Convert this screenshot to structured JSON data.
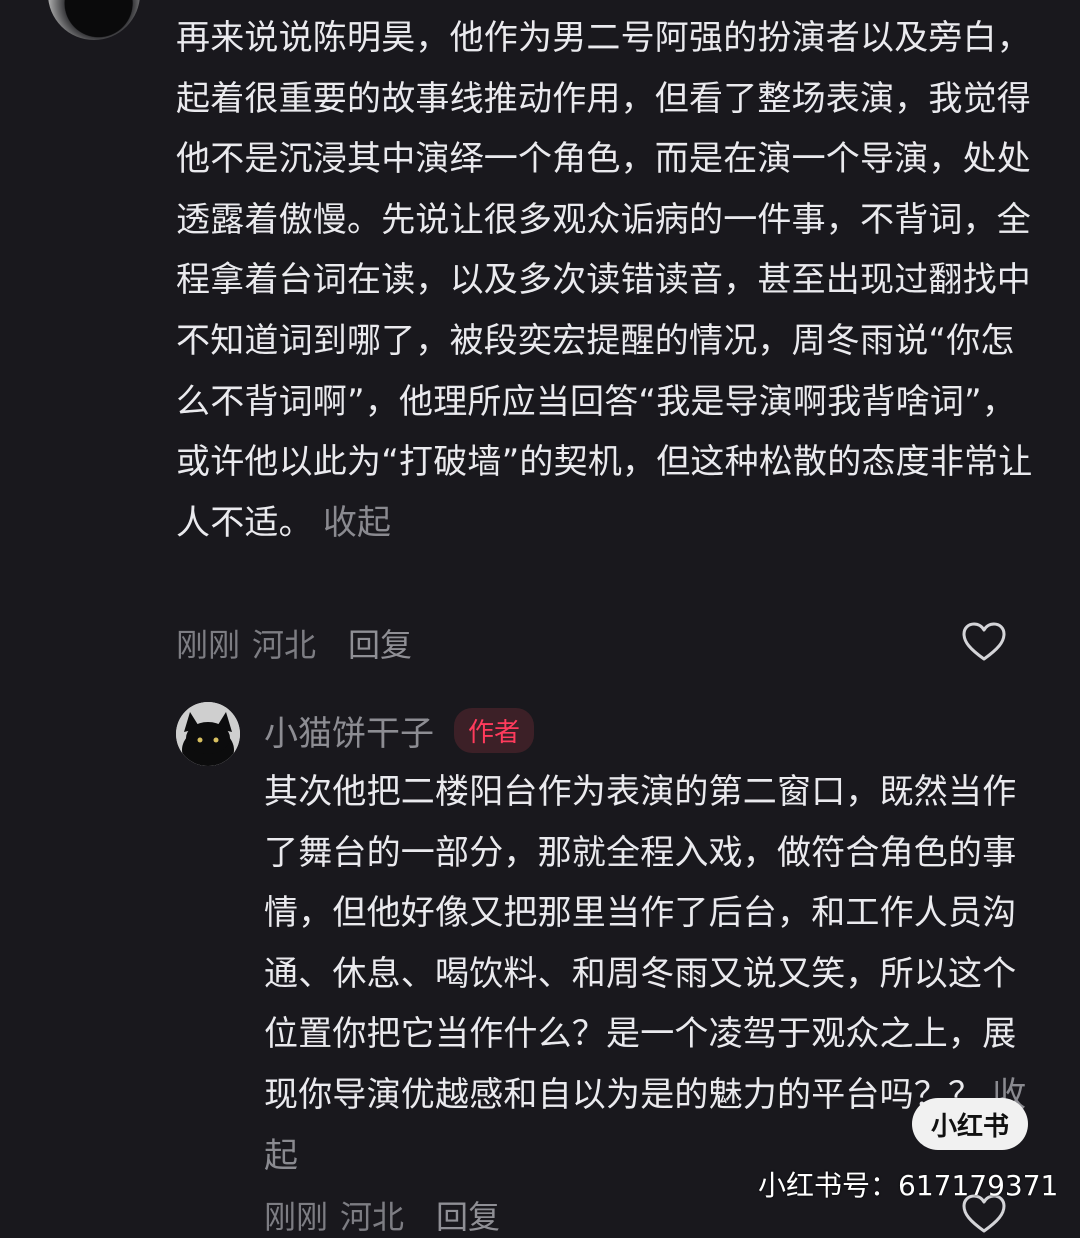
{
  "comment1": {
    "text": "再来说说陈明昊，他作为男二号阿强的扮演者以及旁白，起着很重要的故事线推动作用，但看了整场表演，我觉得他不是沉浸其中演绎一个角色，而是在演一个导演，处处透露着傲慢。先说让很多观众诟病的一件事，不背词，全程拿着台词在读，以及多次读错读音，甚至出现过翻找中不知道词到哪了，被段奕宏提醒的情况，周冬雨说“你怎么不背词啊”，他理所应当回答“我是导演啊我背啥词”，或许他以此为“打破墙”的契机，但这种松散的态度非常让人不适。",
    "collapse_label": "收起",
    "time": "刚刚",
    "location": "河北",
    "reply_label": "回复",
    "like_icon": "heart-outline-icon"
  },
  "reply": {
    "username": "小猫饼干子",
    "badge": "作者",
    "text": "其次他把二楼阳台作为表演的第二窗口，既然当作了舞台的一部分，那就全程入戏，做符合角色的事情，但他好像又把那里当作了后台，和工作人员沟通、休息、喝饮料、和周冬雨又说又笑，所以这个位置你把它当作什么？是一个凌驾于观众之上，展现你导演优越感和自以为是的魅力的平台吗？？",
    "collapse_label": "收起",
    "time": "刚刚",
    "location": "河北",
    "reply_label": "回复",
    "like_icon": "heart-outline-icon"
  },
  "watermark": {
    "logo_text": "小红书",
    "id_text": "小红书号：617179371"
  },
  "colors": {
    "background": "#19181d",
    "text": "#eaeaee",
    "muted": "#7d7d83",
    "badge_bg": "#3c2027",
    "badge_text": "#ff3b5c"
  }
}
